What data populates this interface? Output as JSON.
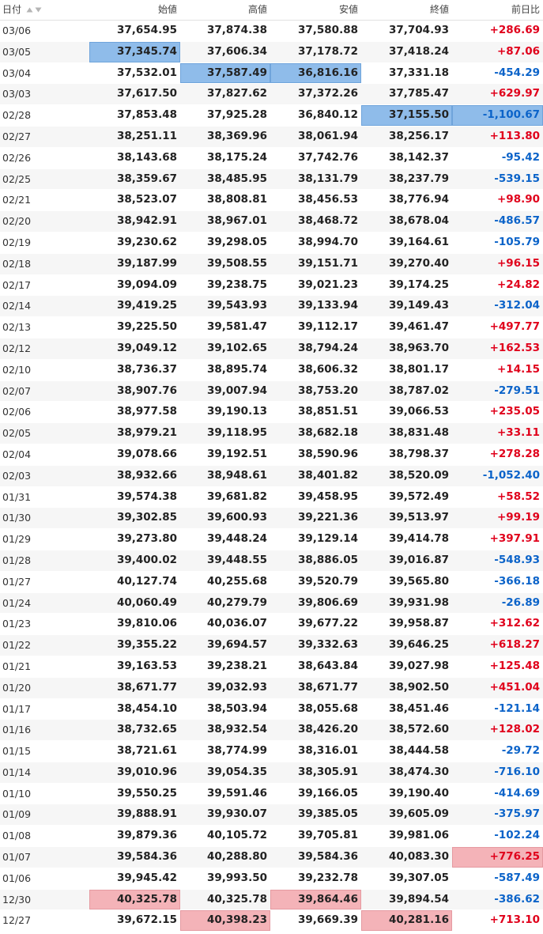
{
  "columns": {
    "date": "日付",
    "open": "始値",
    "high": "高値",
    "low": "安値",
    "close": "終値",
    "change": "前日比"
  },
  "icons": {
    "sort_asc": "sort-ascending-icon",
    "sort_desc": "sort-descending-icon"
  },
  "colors": {
    "positive": "#e0001b",
    "negative": "#0b63c9",
    "highlight_blue": "#8fbcea",
    "highlight_red": "#f4b3b8"
  },
  "rows": [
    {
      "date": "03/06",
      "open": "37,654.95",
      "high": "37,874.38",
      "low": "37,580.88",
      "close": "37,704.93",
      "change": "+286.69",
      "hl": {}
    },
    {
      "date": "03/05",
      "open": "37,345.74",
      "high": "37,606.34",
      "low": "37,178.72",
      "close": "37,418.24",
      "change": "+87.06",
      "hl": {
        "open": "blue"
      }
    },
    {
      "date": "03/04",
      "open": "37,532.01",
      "high": "37,587.49",
      "low": "36,816.16",
      "close": "37,331.18",
      "change": "-454.29",
      "hl": {
        "high": "blue",
        "low": "blue"
      }
    },
    {
      "date": "03/03",
      "open": "37,617.50",
      "high": "37,827.62",
      "low": "37,372.26",
      "close": "37,785.47",
      "change": "+629.97",
      "hl": {}
    },
    {
      "date": "02/28",
      "open": "37,853.48",
      "high": "37,925.28",
      "low": "36,840.12",
      "close": "37,155.50",
      "change": "-1,100.67",
      "hl": {
        "close": "blue",
        "change": "blue"
      }
    },
    {
      "date": "02/27",
      "open": "38,251.11",
      "high": "38,369.96",
      "low": "38,061.94",
      "close": "38,256.17",
      "change": "+113.80",
      "hl": {}
    },
    {
      "date": "02/26",
      "open": "38,143.68",
      "high": "38,175.24",
      "low": "37,742.76",
      "close": "38,142.37",
      "change": "-95.42",
      "hl": {}
    },
    {
      "date": "02/25",
      "open": "38,359.67",
      "high": "38,485.95",
      "low": "38,131.79",
      "close": "38,237.79",
      "change": "-539.15",
      "hl": {}
    },
    {
      "date": "02/21",
      "open": "38,523.07",
      "high": "38,808.81",
      "low": "38,456.53",
      "close": "38,776.94",
      "change": "+98.90",
      "hl": {}
    },
    {
      "date": "02/20",
      "open": "38,942.91",
      "high": "38,967.01",
      "low": "38,468.72",
      "close": "38,678.04",
      "change": "-486.57",
      "hl": {}
    },
    {
      "date": "02/19",
      "open": "39,230.62",
      "high": "39,298.05",
      "low": "38,994.70",
      "close": "39,164.61",
      "change": "-105.79",
      "hl": {}
    },
    {
      "date": "02/18",
      "open": "39,187.99",
      "high": "39,508.55",
      "low": "39,151.71",
      "close": "39,270.40",
      "change": "+96.15",
      "hl": {}
    },
    {
      "date": "02/17",
      "open": "39,094.09",
      "high": "39,238.75",
      "low": "39,021.23",
      "close": "39,174.25",
      "change": "+24.82",
      "hl": {}
    },
    {
      "date": "02/14",
      "open": "39,419.25",
      "high": "39,543.93",
      "low": "39,133.94",
      "close": "39,149.43",
      "change": "-312.04",
      "hl": {}
    },
    {
      "date": "02/13",
      "open": "39,225.50",
      "high": "39,581.47",
      "low": "39,112.17",
      "close": "39,461.47",
      "change": "+497.77",
      "hl": {}
    },
    {
      "date": "02/12",
      "open": "39,049.12",
      "high": "39,102.65",
      "low": "38,794.24",
      "close": "38,963.70",
      "change": "+162.53",
      "hl": {}
    },
    {
      "date": "02/10",
      "open": "38,736.37",
      "high": "38,895.74",
      "low": "38,606.32",
      "close": "38,801.17",
      "change": "+14.15",
      "hl": {}
    },
    {
      "date": "02/07",
      "open": "38,907.76",
      "high": "39,007.94",
      "low": "38,753.20",
      "close": "38,787.02",
      "change": "-279.51",
      "hl": {}
    },
    {
      "date": "02/06",
      "open": "38,977.58",
      "high": "39,190.13",
      "low": "38,851.51",
      "close": "39,066.53",
      "change": "+235.05",
      "hl": {}
    },
    {
      "date": "02/05",
      "open": "38,979.21",
      "high": "39,118.95",
      "low": "38,682.18",
      "close": "38,831.48",
      "change": "+33.11",
      "hl": {}
    },
    {
      "date": "02/04",
      "open": "39,078.66",
      "high": "39,192.51",
      "low": "38,590.96",
      "close": "38,798.37",
      "change": "+278.28",
      "hl": {}
    },
    {
      "date": "02/03",
      "open": "38,932.66",
      "high": "38,948.61",
      "low": "38,401.82",
      "close": "38,520.09",
      "change": "-1,052.40",
      "hl": {}
    },
    {
      "date": "01/31",
      "open": "39,574.38",
      "high": "39,681.82",
      "low": "39,458.95",
      "close": "39,572.49",
      "change": "+58.52",
      "hl": {}
    },
    {
      "date": "01/30",
      "open": "39,302.85",
      "high": "39,600.93",
      "low": "39,221.36",
      "close": "39,513.97",
      "change": "+99.19",
      "hl": {}
    },
    {
      "date": "01/29",
      "open": "39,273.80",
      "high": "39,448.24",
      "low": "39,129.14",
      "close": "39,414.78",
      "change": "+397.91",
      "hl": {}
    },
    {
      "date": "01/28",
      "open": "39,400.02",
      "high": "39,448.55",
      "low": "38,886.05",
      "close": "39,016.87",
      "change": "-548.93",
      "hl": {}
    },
    {
      "date": "01/27",
      "open": "40,127.74",
      "high": "40,255.68",
      "low": "39,520.79",
      "close": "39,565.80",
      "change": "-366.18",
      "hl": {}
    },
    {
      "date": "01/24",
      "open": "40,060.49",
      "high": "40,279.79",
      "low": "39,806.69",
      "close": "39,931.98",
      "change": "-26.89",
      "hl": {}
    },
    {
      "date": "01/23",
      "open": "39,810.06",
      "high": "40,036.07",
      "low": "39,677.22",
      "close": "39,958.87",
      "change": "+312.62",
      "hl": {}
    },
    {
      "date": "01/22",
      "open": "39,355.22",
      "high": "39,694.57",
      "low": "39,332.63",
      "close": "39,646.25",
      "change": "+618.27",
      "hl": {}
    },
    {
      "date": "01/21",
      "open": "39,163.53",
      "high": "39,238.21",
      "low": "38,643.84",
      "close": "39,027.98",
      "change": "+125.48",
      "hl": {}
    },
    {
      "date": "01/20",
      "open": "38,671.77",
      "high": "39,032.93",
      "low": "38,671.77",
      "close": "38,902.50",
      "change": "+451.04",
      "hl": {}
    },
    {
      "date": "01/17",
      "open": "38,454.10",
      "high": "38,503.94",
      "low": "38,055.68",
      "close": "38,451.46",
      "change": "-121.14",
      "hl": {}
    },
    {
      "date": "01/16",
      "open": "38,732.65",
      "high": "38,932.54",
      "low": "38,426.20",
      "close": "38,572.60",
      "change": "+128.02",
      "hl": {}
    },
    {
      "date": "01/15",
      "open": "38,721.61",
      "high": "38,774.99",
      "low": "38,316.01",
      "close": "38,444.58",
      "change": "-29.72",
      "hl": {}
    },
    {
      "date": "01/14",
      "open": "39,010.96",
      "high": "39,054.35",
      "low": "38,305.91",
      "close": "38,474.30",
      "change": "-716.10",
      "hl": {}
    },
    {
      "date": "01/10",
      "open": "39,550.25",
      "high": "39,591.46",
      "low": "39,166.05",
      "close": "39,190.40",
      "change": "-414.69",
      "hl": {}
    },
    {
      "date": "01/09",
      "open": "39,888.91",
      "high": "39,930.07",
      "low": "39,385.05",
      "close": "39,605.09",
      "change": "-375.97",
      "hl": {}
    },
    {
      "date": "01/08",
      "open": "39,879.36",
      "high": "40,105.72",
      "low": "39,705.81",
      "close": "39,981.06",
      "change": "-102.24",
      "hl": {}
    },
    {
      "date": "01/07",
      "open": "39,584.36",
      "high": "40,288.80",
      "low": "39,584.36",
      "close": "40,083.30",
      "change": "+776.25",
      "hl": {
        "change": "red"
      }
    },
    {
      "date": "01/06",
      "open": "39,945.42",
      "high": "39,993.50",
      "low": "39,232.78",
      "close": "39,307.05",
      "change": "-587.49",
      "hl": {}
    },
    {
      "date": "12/30",
      "open": "40,325.78",
      "high": "40,325.78",
      "low": "39,864.46",
      "close": "39,894.54",
      "change": "-386.62",
      "hl": {
        "open": "red",
        "low": "red"
      }
    },
    {
      "date": "12/27",
      "open": "39,672.15",
      "high": "40,398.23",
      "low": "39,669.39",
      "close": "40,281.16",
      "change": "+713.10",
      "hl": {
        "high": "red",
        "close": "red"
      }
    }
  ]
}
